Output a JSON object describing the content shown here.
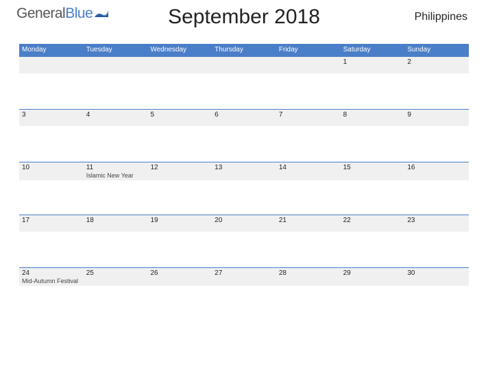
{
  "header": {
    "logo_part1": "General",
    "logo_part2": "Blue",
    "title": "September 2018",
    "country": "Philippines"
  },
  "weekdays": [
    "Monday",
    "Tuesday",
    "Wednesday",
    "Thursday",
    "Friday",
    "Saturday",
    "Sunday"
  ],
  "weeks": [
    {
      "days": [
        {
          "num": "",
          "holiday": ""
        },
        {
          "num": "",
          "holiday": ""
        },
        {
          "num": "",
          "holiday": ""
        },
        {
          "num": "",
          "holiday": ""
        },
        {
          "num": "",
          "holiday": ""
        },
        {
          "num": "1",
          "holiday": ""
        },
        {
          "num": "2",
          "holiday": ""
        }
      ]
    },
    {
      "days": [
        {
          "num": "3",
          "holiday": ""
        },
        {
          "num": "4",
          "holiday": ""
        },
        {
          "num": "5",
          "holiday": ""
        },
        {
          "num": "6",
          "holiday": ""
        },
        {
          "num": "7",
          "holiday": ""
        },
        {
          "num": "8",
          "holiday": ""
        },
        {
          "num": "9",
          "holiday": ""
        }
      ]
    },
    {
      "days": [
        {
          "num": "10",
          "holiday": ""
        },
        {
          "num": "11",
          "holiday": "Islamic New Year"
        },
        {
          "num": "12",
          "holiday": ""
        },
        {
          "num": "13",
          "holiday": ""
        },
        {
          "num": "14",
          "holiday": ""
        },
        {
          "num": "15",
          "holiday": ""
        },
        {
          "num": "16",
          "holiday": ""
        }
      ]
    },
    {
      "days": [
        {
          "num": "17",
          "holiday": ""
        },
        {
          "num": "18",
          "holiday": ""
        },
        {
          "num": "19",
          "holiday": ""
        },
        {
          "num": "20",
          "holiday": ""
        },
        {
          "num": "21",
          "holiday": ""
        },
        {
          "num": "22",
          "holiday": ""
        },
        {
          "num": "23",
          "holiday": ""
        }
      ]
    },
    {
      "days": [
        {
          "num": "24",
          "holiday": "Mid-Autumn Festival"
        },
        {
          "num": "25",
          "holiday": ""
        },
        {
          "num": "26",
          "holiday": ""
        },
        {
          "num": "27",
          "holiday": ""
        },
        {
          "num": "28",
          "holiday": ""
        },
        {
          "num": "29",
          "holiday": ""
        },
        {
          "num": "30",
          "holiday": ""
        }
      ]
    }
  ]
}
